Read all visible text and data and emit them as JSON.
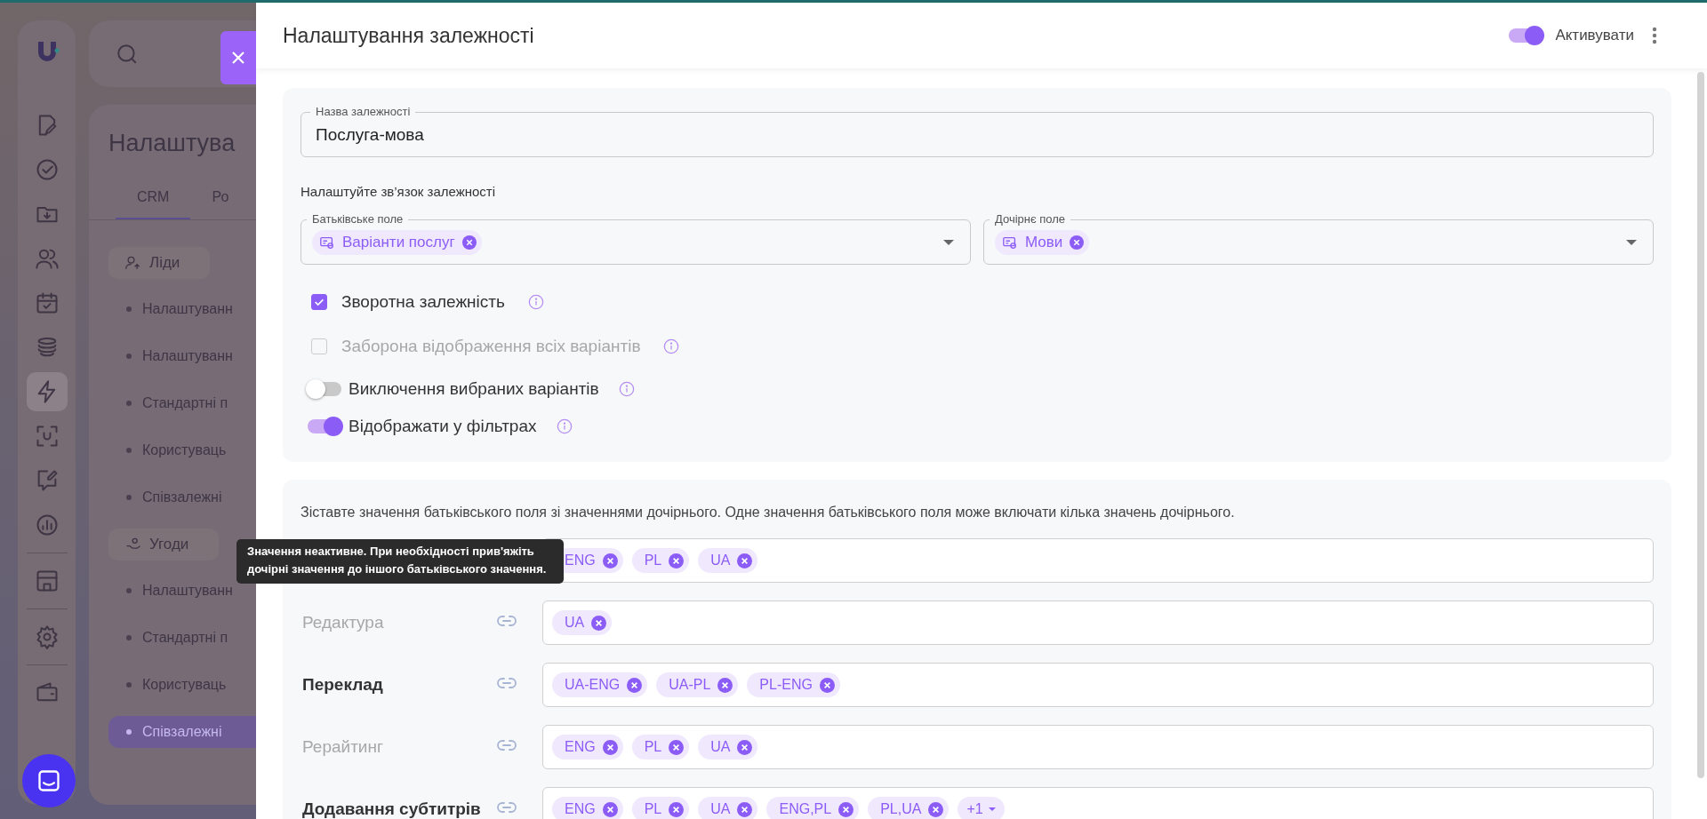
{
  "background": {
    "page_title": "Налаштува",
    "tabs": [
      {
        "label": "CRM",
        "selected": true
      },
      {
        "label": "Ро",
        "selected": false
      }
    ],
    "nav_groups": [
      [
        {
          "kind": "edit",
          "selected": false
        },
        {
          "kind": "check",
          "selected": false
        },
        {
          "kind": "folder",
          "selected": false
        },
        {
          "kind": "users",
          "selected": false
        },
        {
          "kind": "calendar",
          "selected": false
        },
        {
          "kind": "stack",
          "selected": false
        },
        {
          "kind": "bolt",
          "selected": true
        },
        {
          "kind": "scan",
          "selected": false
        },
        {
          "kind": "chat",
          "selected": false
        },
        {
          "kind": "chart",
          "selected": false
        }
      ],
      [
        {
          "kind": "store",
          "selected": false
        }
      ],
      [
        {
          "kind": "gear",
          "selected": false
        }
      ],
      [
        {
          "kind": "wallet",
          "selected": false
        }
      ]
    ],
    "groups": [
      {
        "title": "Ліди",
        "kind": "leads",
        "items": [
          {
            "label": "Налаштуванн",
            "selected": false
          },
          {
            "label": "Налаштуванн",
            "selected": false
          },
          {
            "label": "Стандартні п",
            "selected": false
          },
          {
            "label": "Користуваць",
            "selected": false
          },
          {
            "label": "Співзалежні",
            "selected": false
          }
        ]
      },
      {
        "title": "Угоди",
        "kind": "deals",
        "items": [
          {
            "label": "Налаштуванн",
            "selected": false
          },
          {
            "label": "Стандартні п",
            "selected": false
          },
          {
            "label": "Користуваць",
            "selected": false
          },
          {
            "label": "Співзалежні",
            "selected": true
          }
        ]
      }
    ]
  },
  "panel": {
    "title": "Налаштування залежності",
    "activate": {
      "label": "Активувати",
      "on": true
    },
    "name_field": {
      "label": "Назва залежності",
      "value": "Послуга-мова"
    },
    "link_heading": "Налаштуйте зв’язок залежності",
    "parent_field": {
      "label": "Батьківське поле",
      "tag": "Варіанти послуг"
    },
    "child_field": {
      "label": "Дочірнє поле",
      "tag": "Мови"
    },
    "options": [
      {
        "kind": "checkbox",
        "label": "Зворотна залежність",
        "checked": true,
        "disabled": false
      },
      {
        "kind": "checkbox",
        "label": "Заборона відображення всіх варіантів",
        "checked": false,
        "disabled": true
      },
      {
        "kind": "toggle",
        "label": "Виключення вибраних варіантів",
        "on": false,
        "disabled": false
      },
      {
        "kind": "toggle",
        "label": "Відображати у фільтрах",
        "on": true,
        "disabled": false
      }
    ],
    "mapping": {
      "description": "Зіставте значення батьківського поля зі значеннями дочірнього. Одне значення батьківського поля може включати кілька значень дочірнього.",
      "rows": [
        {
          "tags": [
            "ENG",
            "PL",
            "UA"
          ]
        },
        {
          "label": "Редактура",
          "active": false,
          "tags": [
            "UA"
          ]
        },
        {
          "label": "Переклад",
          "active": true,
          "tags": [
            "UA-ENG",
            "UA-PL",
            "PL-ENG"
          ]
        },
        {
          "label": "Рерайтинг",
          "active": false,
          "tags": [
            "ENG",
            "PL",
            "UA"
          ]
        },
        {
          "label": "Додавання субтитрів",
          "active": true,
          "tags": [
            "ENG",
            "PL",
            "UA",
            "ENG,PL",
            "PL,UA"
          ],
          "more": "+1"
        }
      ]
    }
  },
  "tooltip": "Значення неактивне. При необхідності прив'яжіть дочірні значення до іншого батьківського значення."
}
